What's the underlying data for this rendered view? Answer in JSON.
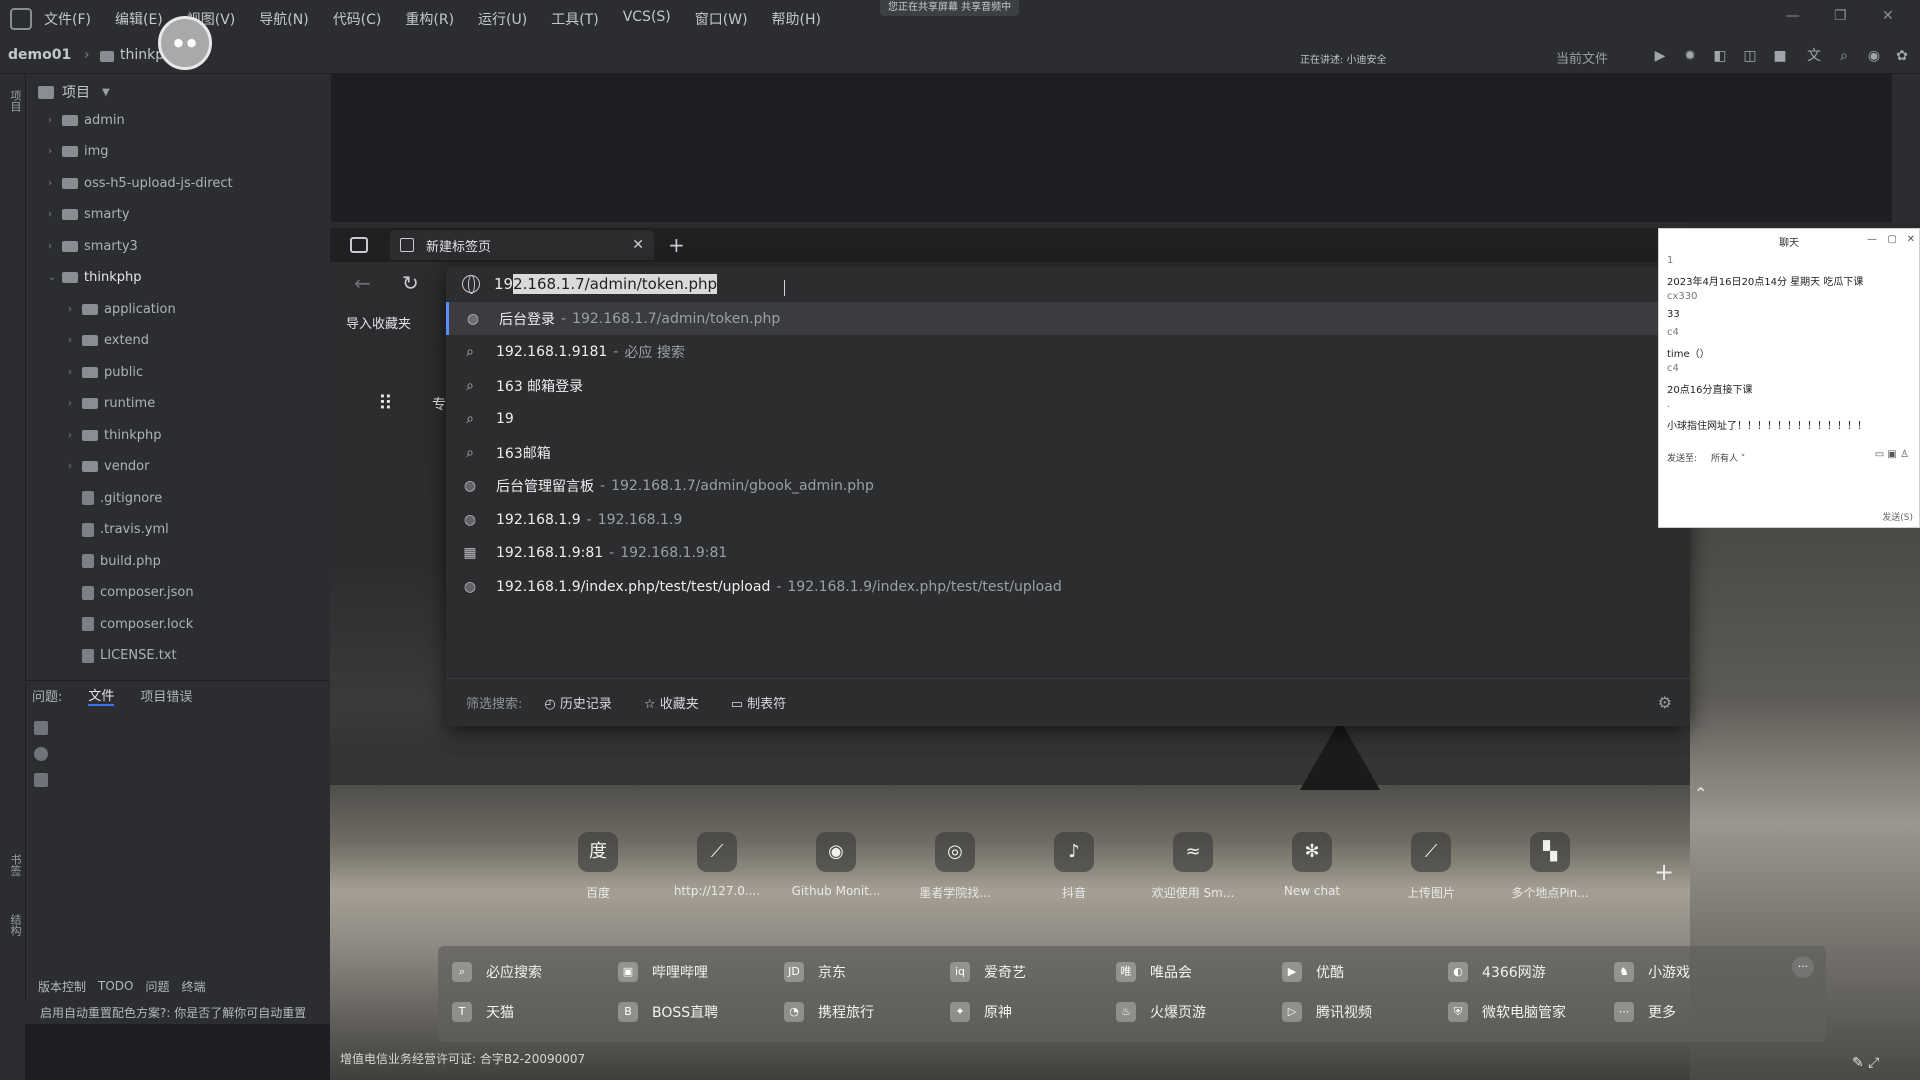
{
  "ide": {
    "menu": [
      "文件(F)",
      "编辑(E)",
      "视图(V)",
      "导航(N)",
      "代码(C)",
      "重构(R)",
      "运行(U)",
      "工具(T)",
      "VCS(S)",
      "窗口(W)",
      "帮助(H)"
    ],
    "share_notice": "您正在共享屏幕  共享音频中",
    "project_name": "demo01",
    "breadcrumb_folder": "thinkphp",
    "sharing_status": "正在讲述: 小迪安全",
    "current_file": "当前文件",
    "panel_title": "项目",
    "tree": [
      {
        "name": "admin",
        "type": "folder",
        "depth": 1
      },
      {
        "name": "img",
        "type": "folder",
        "depth": 1
      },
      {
        "name": "oss-h5-upload-js-direct",
        "type": "folder",
        "depth": 1
      },
      {
        "name": "smarty",
        "type": "folder",
        "depth": 1
      },
      {
        "name": "smarty3",
        "type": "folder",
        "depth": 1
      },
      {
        "name": "thinkphp",
        "type": "folder",
        "depth": 1,
        "expanded": true
      },
      {
        "name": "application",
        "type": "folder",
        "depth": 2
      },
      {
        "name": "extend",
        "type": "folder",
        "depth": 2
      },
      {
        "name": "public",
        "type": "folder",
        "depth": 2
      },
      {
        "name": "runtime",
        "type": "folder",
        "depth": 2
      },
      {
        "name": "thinkphp",
        "type": "folder",
        "depth": 2
      },
      {
        "name": "vendor",
        "type": "folder",
        "depth": 2
      },
      {
        "name": ".gitignore",
        "type": "file",
        "depth": 2
      },
      {
        "name": ".travis.yml",
        "type": "file",
        "depth": 2
      },
      {
        "name": "build.php",
        "type": "file",
        "depth": 2
      },
      {
        "name": "composer.json",
        "type": "file",
        "depth": 2
      },
      {
        "name": "composer.lock",
        "type": "file",
        "depth": 2
      },
      {
        "name": "LICENSE.txt",
        "type": "file",
        "depth": 2
      }
    ],
    "problems_label": "问题:",
    "problems_tabs": [
      "文件",
      "项目错误"
    ],
    "bottom_tools": [
      "版本控制",
      "TODO",
      "问题",
      "终端"
    ],
    "status_text": "启用自动重置配色方案?: 你是否了解你可自动重置",
    "left_strip_labels": [
      "项目",
      "书签",
      "结构"
    ]
  },
  "browser": {
    "tab_title": "新建标签页",
    "import_bookmarks": "导入收藏夹",
    "apps_label": "专",
    "url_typed": "19",
    "url_selected": "2.168.1.7/admin/token.php",
    "suggestions": [
      {
        "icon": "globe",
        "main": "后台登录",
        "sub": "192.168.1.7/admin/token.php",
        "highlight": true
      },
      {
        "icon": "search",
        "main": "192.168.1.9181",
        "sub": "必应 搜索"
      },
      {
        "icon": "search",
        "main": "163 邮箱登录",
        "sub": ""
      },
      {
        "icon": "search",
        "main": "19",
        "sub": ""
      },
      {
        "icon": "search",
        "main": "163邮箱",
        "sub": ""
      },
      {
        "icon": "globe",
        "main": "后台管理留言板",
        "sub": "192.168.1.7/admin/gbook_admin.php"
      },
      {
        "icon": "globe",
        "main": "192.168.1.9",
        "sub": "192.168.1.9"
      },
      {
        "icon": "page",
        "main": "192.168.1.9:81",
        "sub": "192.168.1.9:81"
      },
      {
        "icon": "globe",
        "main": "192.168.1.9/index.php/test/test/upload",
        "sub": "192.168.1.9/index.php/test/test/upload"
      }
    ],
    "filter_label": "筛选搜索:",
    "filter_buttons": [
      "历史记录",
      "收藏夹",
      "制表符"
    ],
    "speed_dial": [
      {
        "label": "百度",
        "icon": "baidu-icon",
        "glyph": "度"
      },
      {
        "label": "http://127.0....",
        "icon": "leaf-icon",
        "glyph": "⟋"
      },
      {
        "label": "Github Monit...",
        "icon": "github-icon",
        "glyph": "◉"
      },
      {
        "label": "墨者学院找...",
        "icon": "mozhe-icon",
        "glyph": "◎"
      },
      {
        "label": "抖音",
        "icon": "douyin-icon",
        "glyph": "♪"
      },
      {
        "label": "欢迎使用 Sm...",
        "icon": "dolphin-icon",
        "glyph": "≈"
      },
      {
        "label": "New chat",
        "icon": "chatgpt-icon",
        "glyph": "✻"
      },
      {
        "label": "上传图片",
        "icon": "leaf-icon",
        "glyph": "⟋"
      },
      {
        "label": "多个地点Pin...",
        "icon": "pin-icon",
        "glyph": "▚"
      }
    ],
    "quick_links": [
      {
        "label": "必应搜索",
        "glyph": "⌕"
      },
      {
        "label": "哔哩哔哩",
        "glyph": "▣"
      },
      {
        "label": "京东",
        "glyph": "JD"
      },
      {
        "label": "爱奇艺",
        "glyph": "iq"
      },
      {
        "label": "唯品会",
        "glyph": "唯"
      },
      {
        "label": "优酷",
        "glyph": "▶"
      },
      {
        "label": "4366网游",
        "glyph": "◐"
      },
      {
        "label": "小游戏",
        "glyph": "♞"
      },
      {
        "label": "天猫",
        "glyph": "T"
      },
      {
        "label": "BOSS直聘",
        "glyph": "B"
      },
      {
        "label": "携程旅行",
        "glyph": "◔"
      },
      {
        "label": "原神",
        "glyph": "✦"
      },
      {
        "label": "火爆页游",
        "glyph": "♨"
      },
      {
        "label": "腾讯视频",
        "glyph": "▷"
      },
      {
        "label": "微软电脑管家",
        "glyph": "⛨"
      },
      {
        "label": "更多",
        "glyph": "⋯"
      }
    ],
    "license": "增值电信业务经营许可证: 合字B2-20090007"
  },
  "chat": {
    "title": "聊天",
    "lines": [
      {
        "text": "1",
        "dim": true
      },
      {
        "text": "2023年4月16日20点14分 星期天 吃瓜下课",
        "dim": false
      },
      {
        "text": "cx330",
        "dim": true
      },
      {
        "text": "33",
        "dim": false
      },
      {
        "text": "c4",
        "dim": true
      },
      {
        "text": "time（）",
        "dim": false
      },
      {
        "text": "c4",
        "dim": true
      },
      {
        "text": "20点16分直接下课",
        "dim": false
      },
      {
        "text": ".",
        "dim": true
      },
      {
        "text": "小球指住网址了！！！！！！！！！！！！！",
        "dim": false
      }
    ],
    "send_label": "发送至:",
    "send_to": "所有人 ˅",
    "send_button": "发送(S)"
  }
}
